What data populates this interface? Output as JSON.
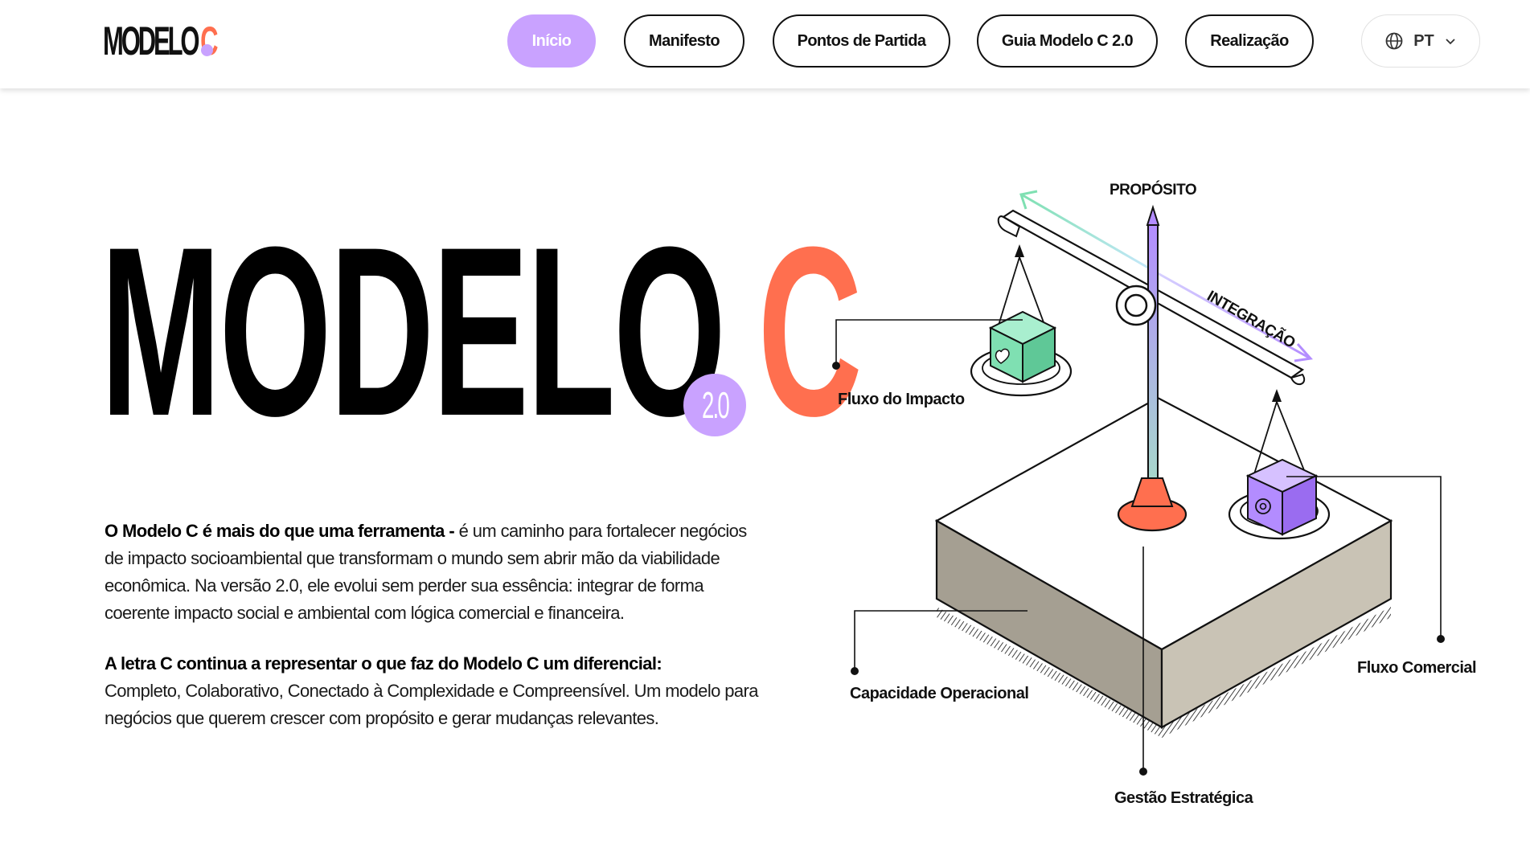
{
  "header": {
    "logo": {
      "text_black": "MODELO",
      "text_accent": "C"
    },
    "nav": [
      {
        "label": "Início",
        "active": true
      },
      {
        "label": "Manifesto",
        "active": false
      },
      {
        "label": "Pontos de Partida",
        "active": false
      },
      {
        "label": "Guia Modelo C 2.0",
        "active": false
      },
      {
        "label": "Realização",
        "active": false
      }
    ],
    "language": {
      "label": "PT",
      "icon": "globe-icon",
      "chevron": "chevron-down-icon"
    }
  },
  "hero": {
    "title_black": "MODELO",
    "title_accent": "C",
    "version": "2.0"
  },
  "paragraphs": {
    "p1_bold": "O Modelo C é mais do que uma ferramenta -",
    "p1_text": " é um caminho para fortalecer negócios de impacto socioambiental que transformam o mundo sem abrir mão da viabilidade econômica. Na versão 2.0, ele evolui sem perder sua essência: integrar de forma coerente impacto social e ambiental com lógica comercial e financeira.",
    "p2_bold": "A letra C continua a representar o que faz do Modelo C um diferencial:",
    "p2_text": "Completo, Colaborativo, Conectado à Complexidade e Compreensível. Um modelo para negócios que querem crescer com propósito e gerar mudanças relevantes."
  },
  "illustration": {
    "labels": {
      "proposito": "PROPÓSITO",
      "integracao": "INTEGRAÇÃO",
      "fluxo_impacto": "Fluxo do Impacto",
      "fluxo_comercial": "Fluxo Comercial",
      "capacidade": "Capacidade Operacional",
      "gestao": "Gestão Estratégica"
    }
  },
  "colors": {
    "accent_orange": "#ff6f4f",
    "accent_purple": "#c9a2ff",
    "box_green": "#7fe0b2",
    "box_purple": "#b38cff",
    "platform_side": "#a59f92"
  }
}
